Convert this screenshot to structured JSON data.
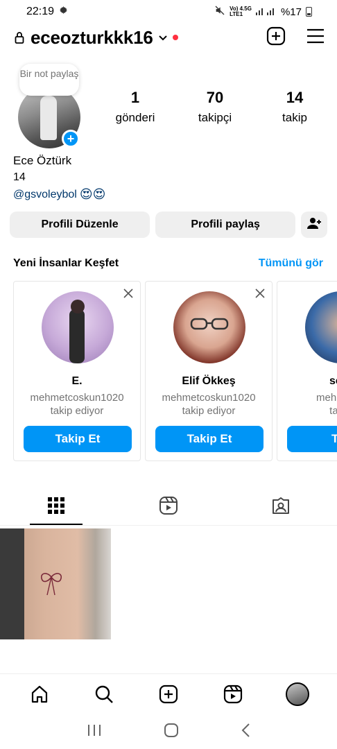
{
  "status_bar": {
    "time": "22:19",
    "network": "Vo) 4.5G",
    "network2": "LTE1",
    "battery": "%17"
  },
  "header": {
    "username": "eceozturkkk16"
  },
  "profile": {
    "note": "Bir not paylaş",
    "stats": [
      {
        "value": "1",
        "label": "gönderi"
      },
      {
        "value": "70",
        "label": "takipçi"
      },
      {
        "value": "14",
        "label": "takip"
      }
    ],
    "full_name": "Ece Öztürk",
    "bio": "14",
    "link": "@gsvoleybol",
    "link_emojis": "😍😍"
  },
  "buttons": {
    "edit": "Profili Düzenle",
    "share": "Profili paylaş"
  },
  "discover": {
    "title": "Yeni İnsanlar Keşfet",
    "see_all": "Tümünü gör",
    "cards": [
      {
        "name": "E.",
        "subtitle_line1": "mehmetcoskun1020",
        "subtitle_line2": "takip ediyor",
        "button": "Takip Et"
      },
      {
        "name": "Elif Ökkeş",
        "subtitle_line1": "mehmetcoskun1020",
        "subtitle_line2": "takip ediyor",
        "button": "Takip Et"
      },
      {
        "name": "sem",
        "subtitle_line1": "mehmetco",
        "subtitle_line2": "takip",
        "button": "Tak"
      }
    ]
  },
  "colors": {
    "accent": "#0095f6",
    "link": "#00376b",
    "muted": "#737373",
    "button_bg": "#efefef",
    "notification_dot": "#ff3040"
  },
  "icons": {
    "header": [
      "lock-icon",
      "chevron-down-icon",
      "new-post-icon",
      "menu-icon"
    ],
    "tabs": [
      "grid-icon",
      "reels-icon",
      "tagged-icon"
    ],
    "bottom_nav": [
      "home-icon",
      "search-icon",
      "create-icon",
      "reels-icon",
      "profile-avatar"
    ],
    "system_nav": [
      "recents-icon",
      "home-circle-icon",
      "back-icon"
    ]
  }
}
